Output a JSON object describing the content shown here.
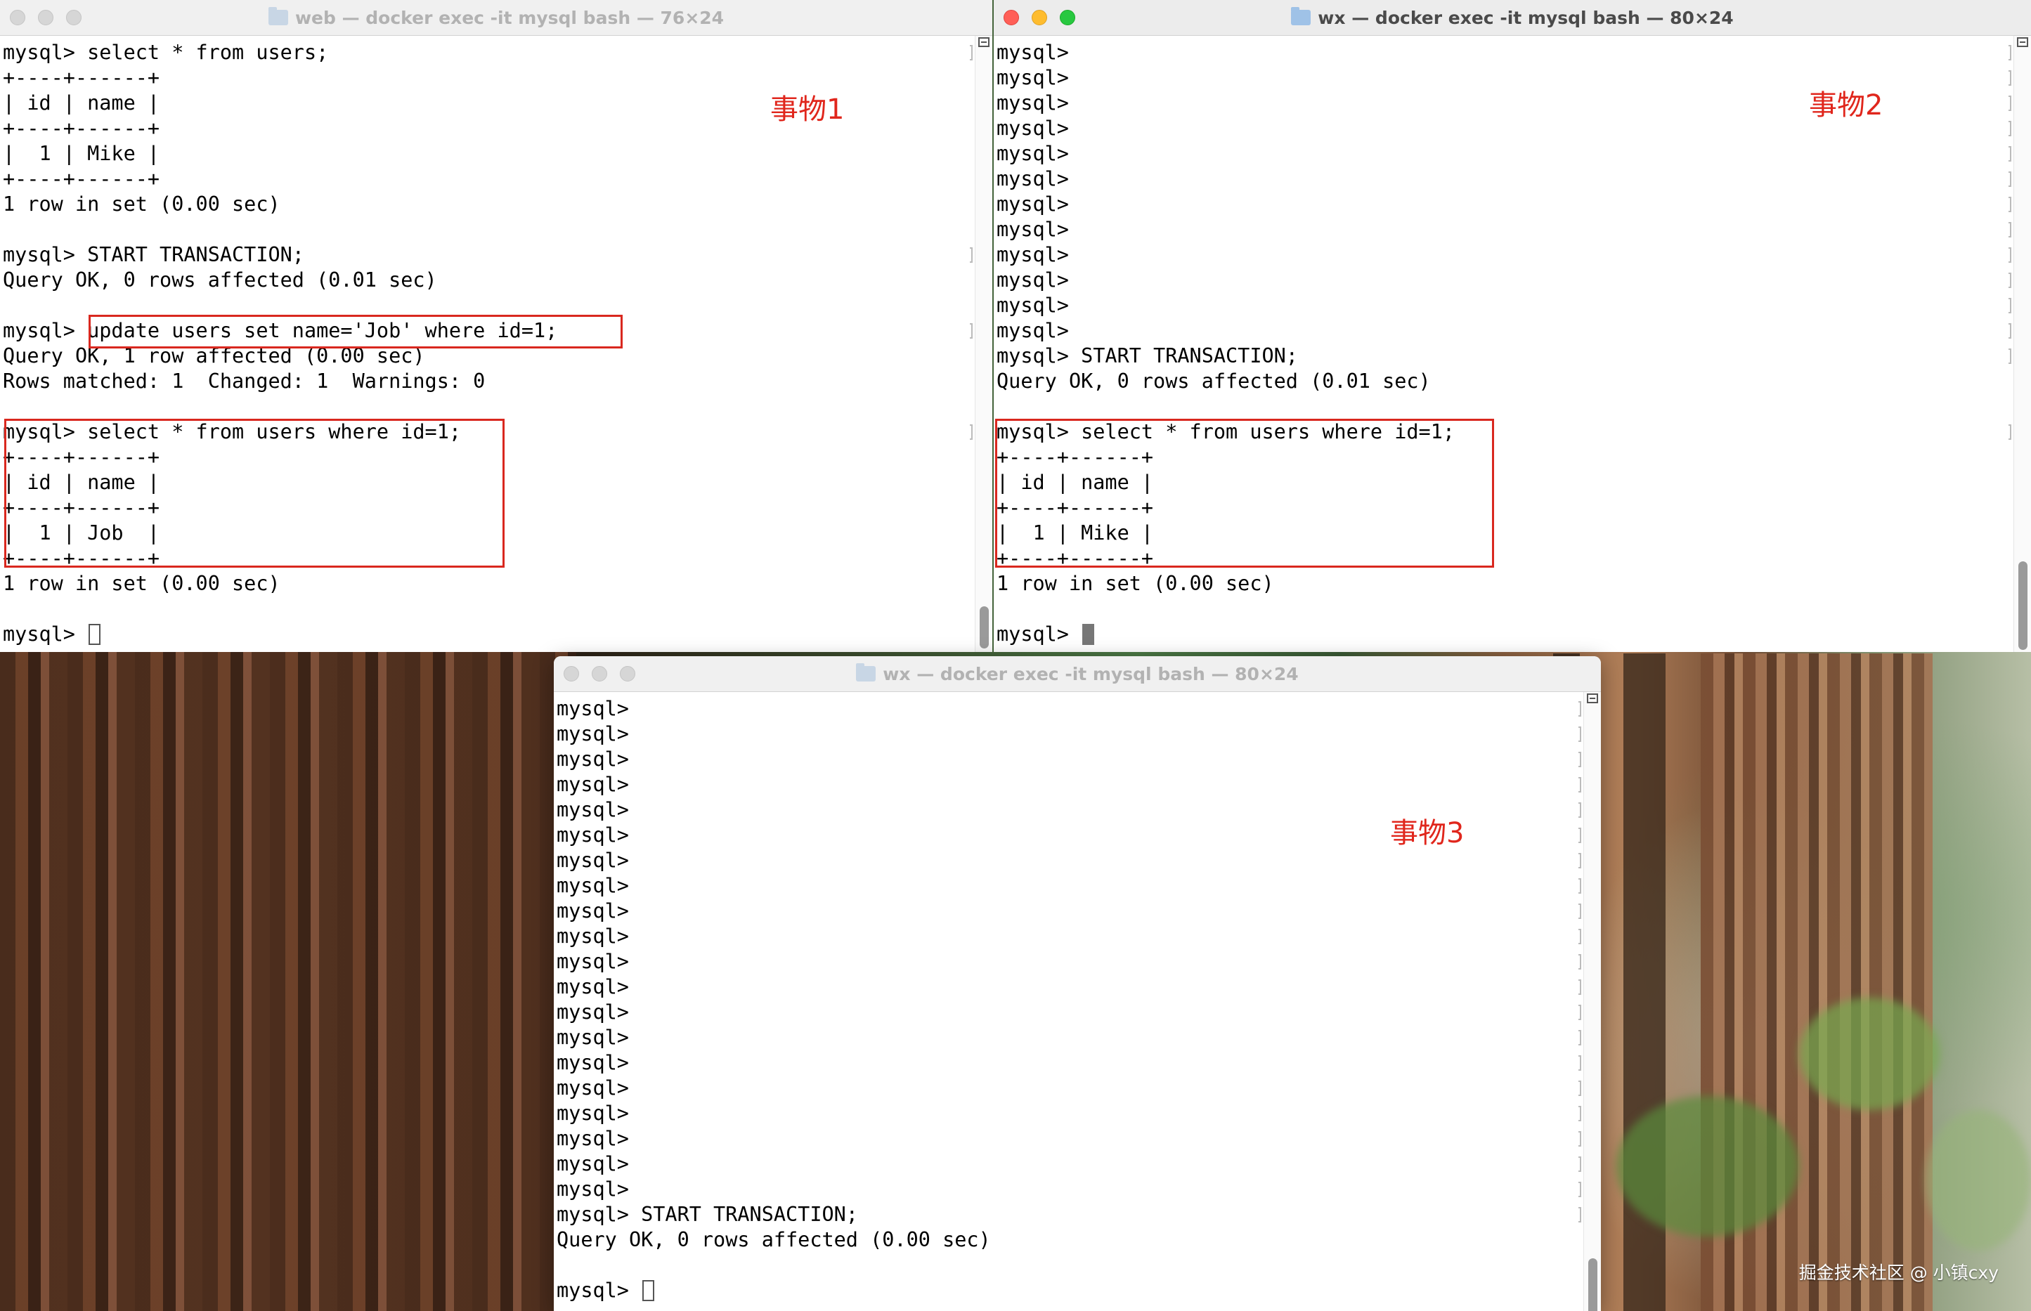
{
  "watermark": "掘金技术社区 @ 小镇cxy",
  "windows": [
    {
      "id": "web",
      "title": "web — docker exec -it mysql bash — 76×24",
      "annotation": "事物1",
      "lines": [
        "mysql> select * from users;",
        "+----+------+",
        "| id | name |",
        "+----+------+",
        "|  1 | Mike |",
        "+----+------+",
        "1 row in set (0.00 sec)",
        "",
        "mysql> START TRANSACTION;",
        "Query OK, 0 rows affected (0.01 sec)",
        "",
        "mysql> update users set name='Job' where id=1;",
        "Query OK, 1 row affected (0.00 sec)",
        "Rows matched: 1  Changed: 1  Warnings: 0",
        "",
        "mysql> select * from users where id=1;",
        "+----+------+",
        "| id | name |",
        "+----+------+",
        "|  1 | Job  |",
        "+----+------+",
        "1 row in set (0.00 sec)",
        "",
        "mysql> "
      ]
    },
    {
      "id": "wx-top",
      "title": "wx — docker exec -it mysql bash — 80×24",
      "annotation": "事物2",
      "lines": [
        "mysql>",
        "mysql>",
        "mysql>",
        "mysql>",
        "mysql>",
        "mysql>",
        "mysql>",
        "mysql>",
        "mysql>",
        "mysql>",
        "mysql>",
        "mysql>",
        "mysql> START TRANSACTION;",
        "Query OK, 0 rows affected (0.01 sec)",
        "",
        "mysql> select * from users where id=1;",
        "+----+------+",
        "| id | name |",
        "+----+------+",
        "|  1 | Mike |",
        "+----+------+",
        "1 row in set (0.00 sec)",
        "",
        "mysql> "
      ]
    },
    {
      "id": "wx-bottom",
      "title": "wx — docker exec -it mysql bash — 80×24",
      "annotation": "事物3",
      "lines": [
        "mysql>",
        "mysql>",
        "mysql>",
        "mysql>",
        "mysql>",
        "mysql>",
        "mysql>",
        "mysql>",
        "mysql>",
        "mysql>",
        "mysql>",
        "mysql>",
        "mysql>",
        "mysql>",
        "mysql>",
        "mysql>",
        "mysql>",
        "mysql>",
        "mysql>",
        "mysql>",
        "mysql> START TRANSACTION;",
        "Query OK, 0 rows affected (0.00 sec)",
        "",
        "mysql> "
      ]
    }
  ],
  "colors": {
    "annotation_red": "#e0261c",
    "highlight_red": "#d9281f"
  }
}
